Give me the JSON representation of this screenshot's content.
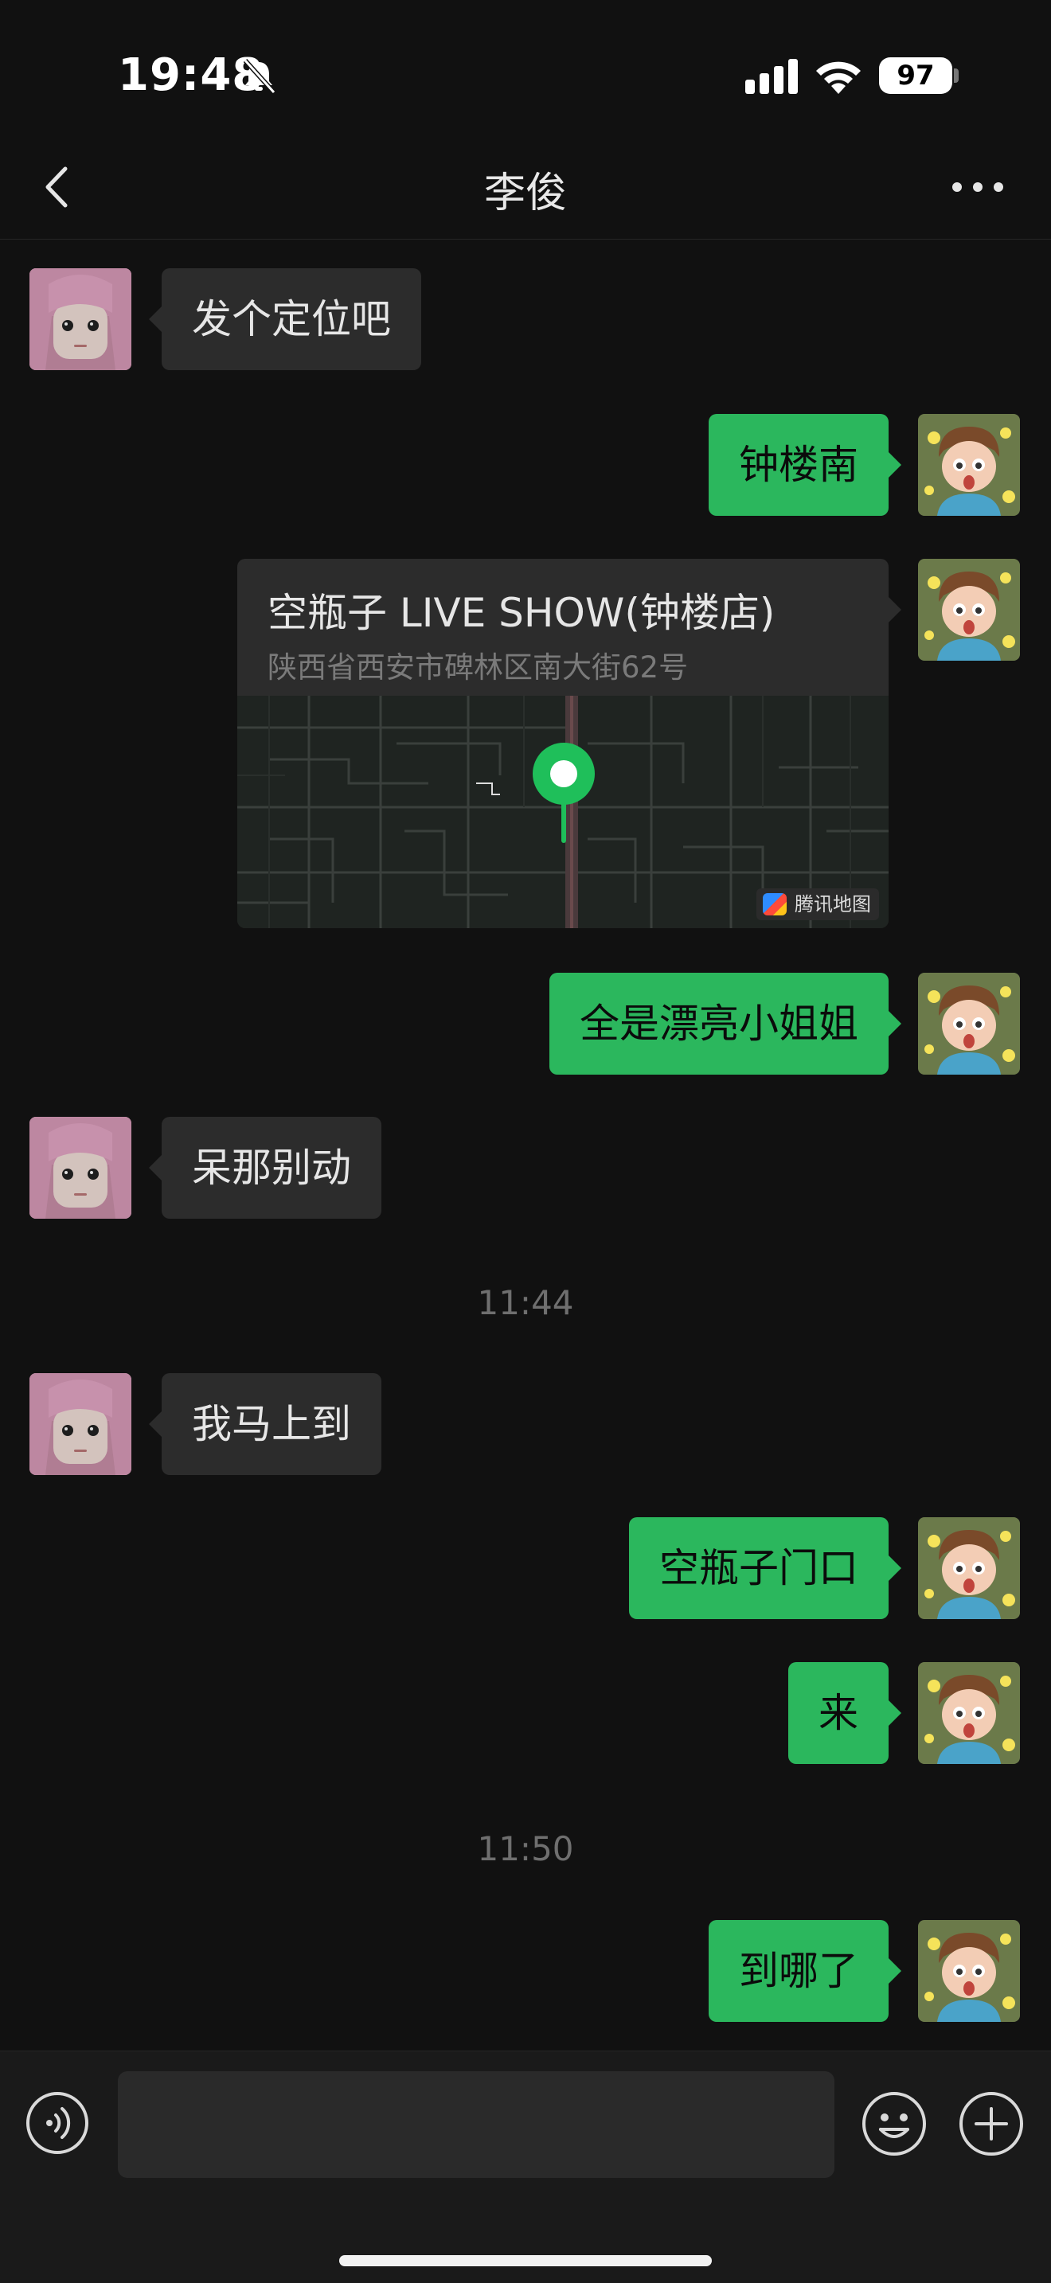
{
  "status_bar": {
    "time": "19:48",
    "battery": "97",
    "icons": [
      "bell-muted-icon",
      "cellular-signal-icon",
      "wifi-icon",
      "battery-icon"
    ]
  },
  "nav": {
    "title": "李俊",
    "icons": [
      "chevron-left-icon",
      "more-dots-icon"
    ]
  },
  "messages": [
    {
      "side": "in",
      "type": "text",
      "text": "发个定位吧"
    },
    {
      "side": "out",
      "type": "text",
      "text": "钟楼南"
    },
    {
      "side": "out",
      "type": "location",
      "name": "空瓶子 LIVE SHOW(钟楼店)",
      "address": "陕西省西安市碑林区南大街62号",
      "map_provider": "腾讯地图"
    },
    {
      "side": "out",
      "type": "text",
      "text": "全是漂亮小姐姐"
    },
    {
      "side": "in",
      "type": "text",
      "text": "呆那别动"
    },
    {
      "type": "timestamp",
      "text": "11:44"
    },
    {
      "side": "in",
      "type": "text",
      "text": "我马上到"
    },
    {
      "side": "out",
      "type": "text",
      "text": "空瓶子门口"
    },
    {
      "side": "out",
      "type": "text",
      "text": "来"
    },
    {
      "type": "timestamp",
      "text": "11:50"
    },
    {
      "side": "out",
      "type": "text",
      "text": "到哪了"
    }
  ],
  "input_bar": {
    "value": "",
    "icons": [
      "voice-icon",
      "emoji-icon",
      "plus-icon"
    ]
  },
  "colors": {
    "background": "#111111",
    "incoming_bubble": "#2c2c2c",
    "outgoing_bubble": "#2bb75d",
    "map_pin": "#1fbf5a"
  }
}
